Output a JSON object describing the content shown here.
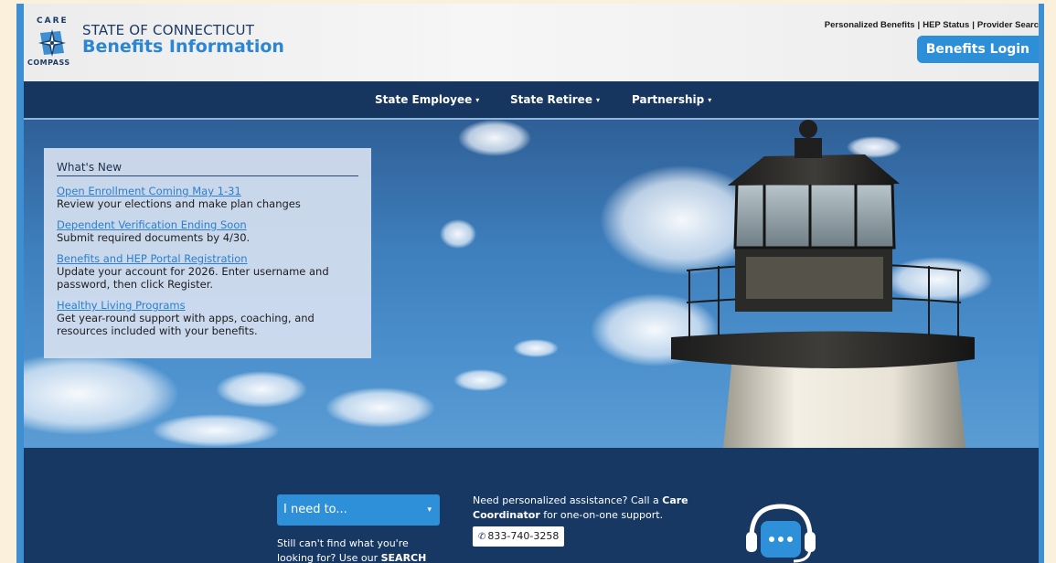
{
  "header": {
    "logo_top": "CARE",
    "logo_bottom": "COMPASS",
    "state": "STATE OF CONNECTICUT",
    "title": "Benefits Information",
    "top_links": [
      "Personalized Benefits",
      "HEP Status",
      "Provider Searc"
    ],
    "login": "Benefits Login"
  },
  "nav": {
    "items": [
      {
        "label": "State Employee",
        "caret": "▾"
      },
      {
        "label": "State Retiree",
        "caret": "▾"
      },
      {
        "label": "Partnership",
        "caret": "▾"
      }
    ]
  },
  "whats_new": {
    "title": "What's New",
    "items": [
      {
        "link": "Open Enrollment Coming May 1-31",
        "desc": "Review your elections and make plan changes"
      },
      {
        "link": "Dependent Verification Ending Soon",
        "desc": "Submit required documents by 4/30."
      },
      {
        "link": "Benefits and HEP Portal Registration",
        "desc": "Update your account for 2026. Enter username and password, then click Register."
      },
      {
        "link": "Healthy Living Programs",
        "desc": "Get year-round support with apps, coaching, and resources included with your benefits."
      }
    ]
  },
  "footer": {
    "select_value": "I need to...",
    "select_arrow": "▾",
    "cant_find_prefix": "Still can't find what you're looking for? Use our ",
    "cant_find_bold": "SEARCH",
    "assist_prefix": "Need personalized assistance? Call a ",
    "assist_bold": "Care Coordinator",
    "assist_suffix": " for one-on-one support.",
    "phone": "833-740-3258"
  },
  "icons": {
    "phone": "phone-icon",
    "support": "headset-chat-icon",
    "logo": "compass-star-icon"
  },
  "colors": {
    "accent": "#2d8fd8",
    "nav_bg": "#163660",
    "footer_bg": "#173862",
    "link": "#2a7fd0"
  }
}
